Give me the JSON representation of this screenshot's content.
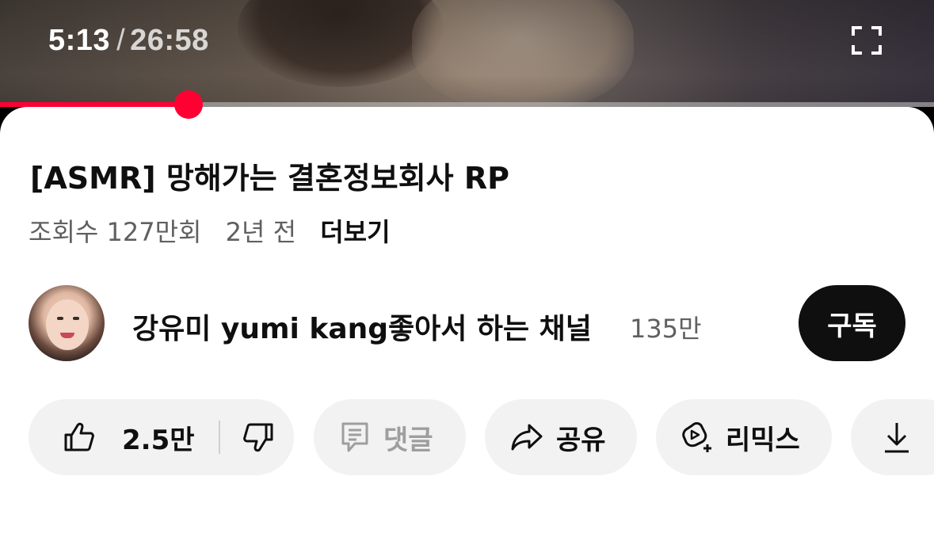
{
  "player": {
    "current_time": "5:13",
    "separator": "/",
    "duration": "26:58",
    "progress_fraction": 0.193,
    "accent_color": "#ff0033"
  },
  "video": {
    "title": "[ASMR] 망해가는 결혼정보회사 RP",
    "views": "조회수 127만회",
    "age": "2년 전",
    "more_label": "더보기"
  },
  "channel": {
    "name": "강유미 yumi kang좋아서 하는 채널",
    "subscribers": "135만",
    "subscribe_label": "구독"
  },
  "actions": {
    "like_count": "2.5만",
    "comment_label": "댓글",
    "share_label": "공유",
    "remix_label": "리믹스"
  },
  "icons": {
    "fullscreen": "fullscreen-icon",
    "like": "thumbs-up-icon",
    "dislike": "thumbs-down-icon",
    "comment": "comment-icon",
    "share": "share-arrow-icon",
    "remix": "remix-icon",
    "download": "download-icon"
  }
}
